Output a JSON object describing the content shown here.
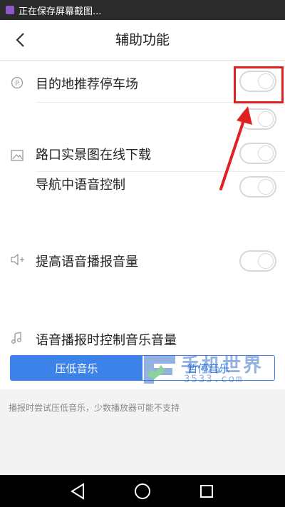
{
  "status_bar": {
    "notification": "正在保存屏幕截图..."
  },
  "header": {
    "title": "辅助功能"
  },
  "settings": {
    "parking": "目的地推荐停车场",
    "road_map_download": "路口实景图在线下载",
    "voice_control": "导航中语音控制",
    "volume_boost": "提高语音播报音量"
  },
  "music": {
    "label": "语音播报时控制音乐音量",
    "lower_option": "压低音乐",
    "pause_option": "暂停音乐",
    "selected": "压低音乐"
  },
  "footnote": "播报时尝试压低音乐，少数播放器可能不支持",
  "watermark": {
    "text": "手机世界",
    "url": "3533.com"
  },
  "colors": {
    "accent": "#3d82e8",
    "highlight": "#e02020"
  }
}
